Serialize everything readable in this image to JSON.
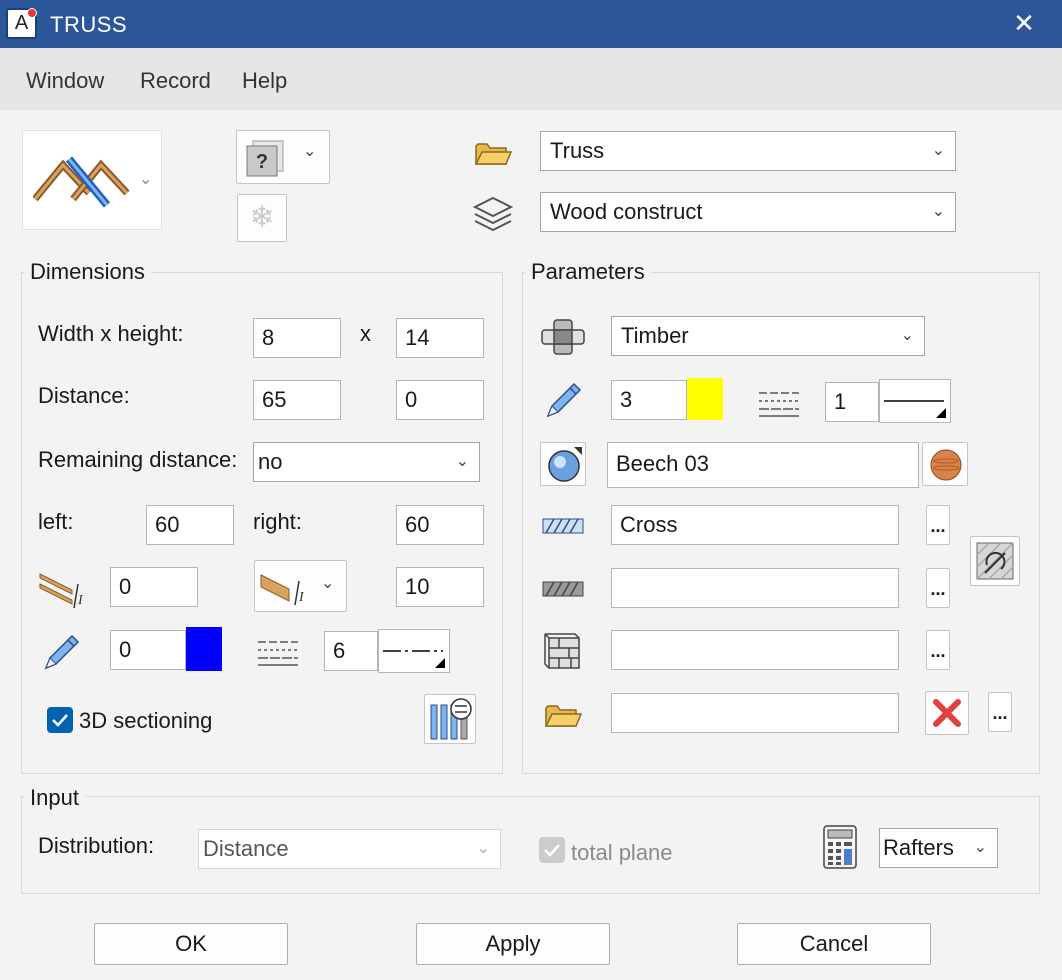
{
  "window": {
    "title": "TRUSS",
    "close_glyph": "✕",
    "app_icon_letter": "A"
  },
  "menu": [
    "Window",
    "Record",
    "Help"
  ],
  "top": {
    "folder_value": "Truss",
    "layer_value": "Wood construct",
    "help_glyph": "?",
    "snowflake_glyph": "❄"
  },
  "dimensions": {
    "title": "Dimensions",
    "width_height_label": "Width x height:",
    "width": "8",
    "x_sep": "x",
    "height": "14",
    "distance_label": "Distance:",
    "distance": "65",
    "distance_offset": "0",
    "remaining_label": "Remaining distance:",
    "remaining_value": "no",
    "left_label": "left:",
    "left": "60",
    "right_label": "right:",
    "right": "60",
    "offset_a": "0",
    "offset_b": "10",
    "pen_value": "0",
    "pen_color": "#0000ff",
    "line_value": "6",
    "sectioning_label": "3D sectioning",
    "sectioning_checked": true
  },
  "parameters": {
    "title": "Parameters",
    "material_type": "Timber",
    "pen_value": "3",
    "pen_color": "#ffff00",
    "line_value": "1",
    "surface_value": "Beech 03",
    "hatch_value": "Cross",
    "fill_value": "",
    "pattern_value": "",
    "file_value": "",
    "dots": "..."
  },
  "input": {
    "title": "Input",
    "distribution_label": "Distribution:",
    "distribution_value": "Distance",
    "total_plane_label": "total plane",
    "rafters_value": "Rafters"
  },
  "buttons": {
    "ok": "OK",
    "apply": "Apply",
    "cancel": "Cancel"
  },
  "colors": {
    "accent": "#2b579a",
    "checkbox": "#0063b1",
    "delete": "#e04040"
  }
}
